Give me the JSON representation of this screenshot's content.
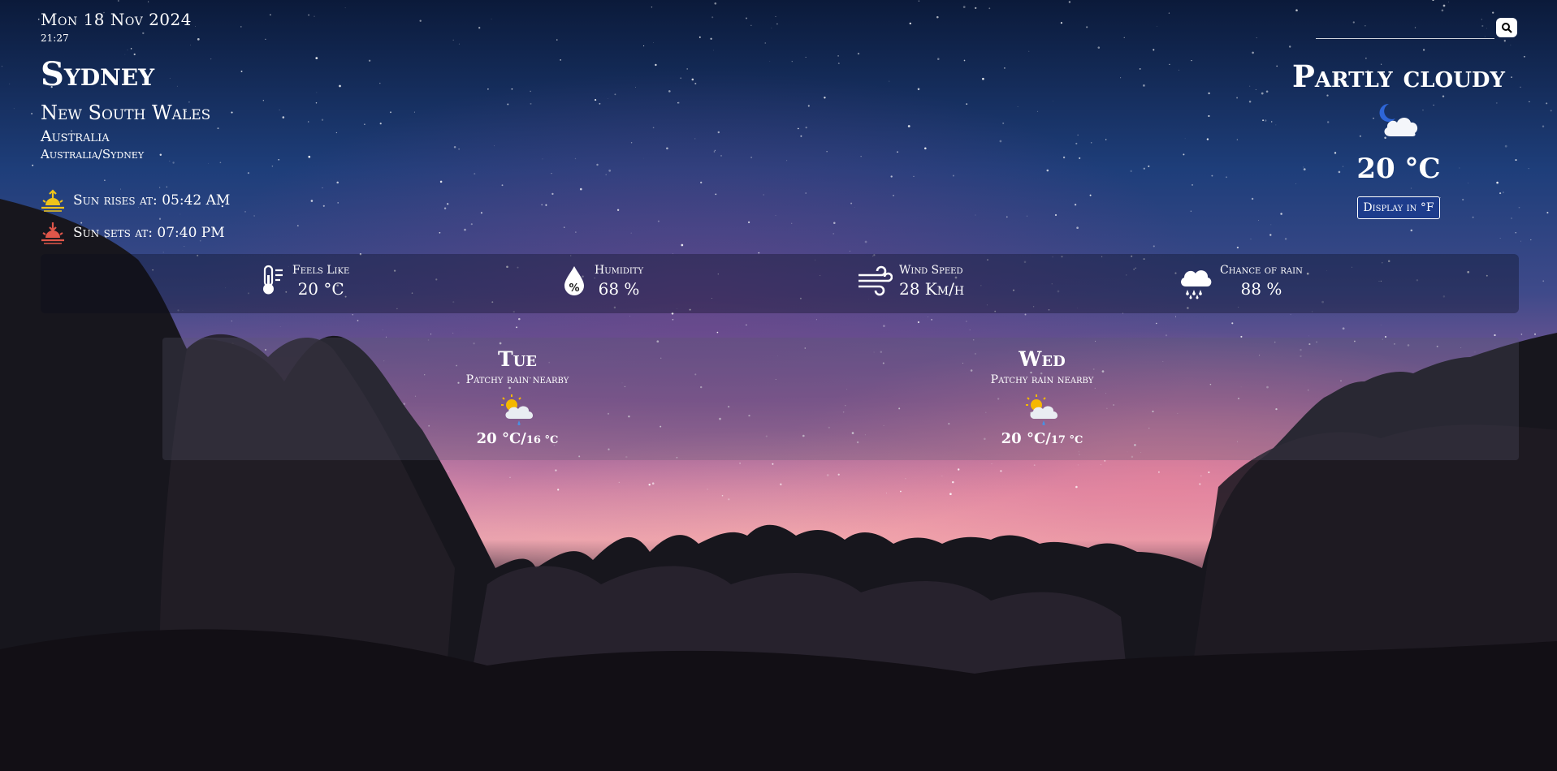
{
  "header": {
    "date": "Mon 18 Nov 2024",
    "time": "21:27"
  },
  "location": {
    "city": "Sydney",
    "region": "New South Wales",
    "country": "Australia",
    "timezone": "Australia/Sydney"
  },
  "sun": {
    "sunrise_label": "Sun rises at: 05:42 AM",
    "sunset_label": "Sun sets at: 07:40 PM"
  },
  "search": {
    "placeholder": "",
    "value": "",
    "icon": "search-icon"
  },
  "current": {
    "condition": "Partly cloudy",
    "icon": "moon-cloud-icon",
    "temperature": "20 °C",
    "unit_toggle_label": "Display in °F"
  },
  "metrics": [
    {
      "label": "Feels Like",
      "value": "20 °C",
      "icon": "thermometer-icon"
    },
    {
      "label": "Humidity",
      "value": "68 %",
      "icon": "humidity-drop-icon"
    },
    {
      "label": "Wind Speed",
      "value": "28 Km/h",
      "icon": "wind-icon"
    },
    {
      "label": "Chance of rain",
      "value": "88 %",
      "icon": "rain-cloud-icon"
    }
  ],
  "forecast": [
    {
      "day": "Tue",
      "condition": "Patchy rain nearby",
      "high": "20 °C/",
      "low": "16 °C",
      "icon": "sun-rain-cloud-icon"
    },
    {
      "day": "Wed",
      "condition": "Patchy rain nearby",
      "high": "20 °C/",
      "low": "17 °C",
      "icon": "sun-rain-cloud-icon"
    }
  ],
  "colors": {
    "button_bg": "#1d3c8c",
    "sunrise_icon": "#f0c419",
    "sunset_icon": "#e0564a"
  }
}
